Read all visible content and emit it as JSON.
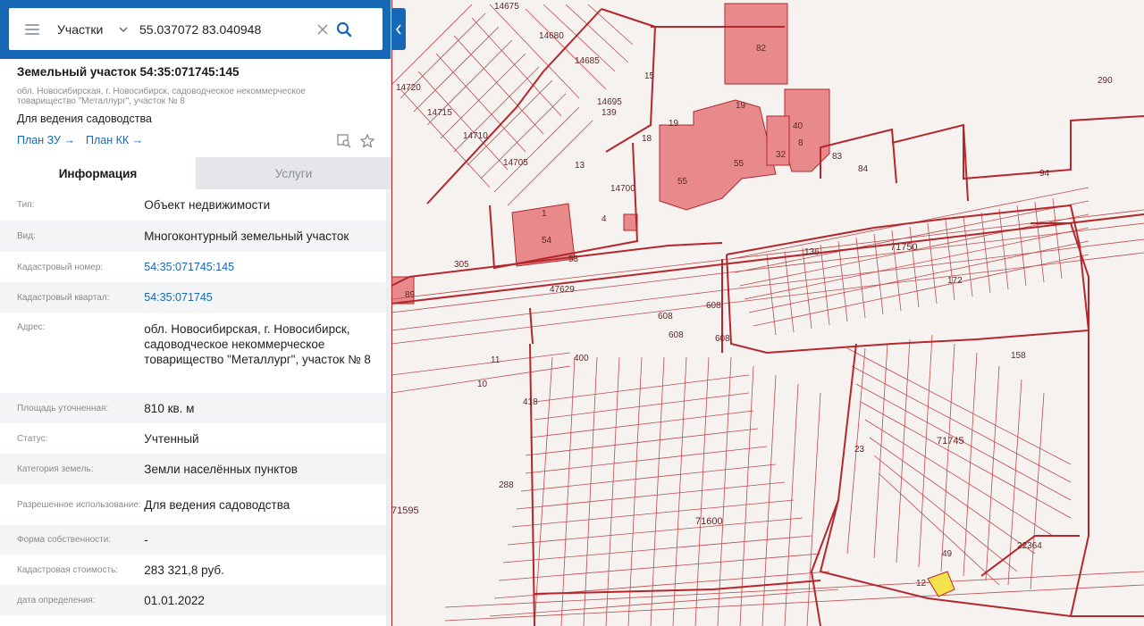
{
  "search": {
    "type_label": "Участки",
    "query": "55.037072 83.040948"
  },
  "parcel": {
    "title": "Земельный участок 54:35:071745:145",
    "address_short": "обл. Новосибирская, г. Новосибирск, садоводческое некоммерческое товарищество \"Металлург\", участок № 8",
    "purpose": "Для ведения садоводства",
    "plan_zu": "План ЗУ →",
    "plan_kk": "План КК →"
  },
  "tabs": [
    {
      "label": "Информация",
      "active": true
    },
    {
      "label": "Услуги",
      "active": false
    }
  ],
  "info_rows": [
    {
      "key": "Тип:",
      "value": "Объект недвижимости"
    },
    {
      "key": "Вид:",
      "value": "Многоконтурный земельный участок"
    },
    {
      "key": "Кадастровый номер:",
      "value": "54:35:071745:145",
      "link": true
    },
    {
      "key": "Кадастровый квартал:",
      "value": "54:35:071745",
      "link": true
    },
    {
      "key": "Адрес:",
      "value": "обл. Новосибирская, г. Новосибирск, садоводческое некоммерческое товарищество \"Металлург\", участок № 8"
    },
    {
      "key": "Площадь уточненная:",
      "value": "810 кв. м"
    },
    {
      "key": "Статус:",
      "value": "Учтенный"
    },
    {
      "key": "Категория земель:",
      "value": "Земли населённых пунктов"
    },
    {
      "key": "Разрешенное использование:",
      "value": "Для ведения садоводства"
    },
    {
      "key": "Форма собственности:",
      "value": "-"
    },
    {
      "key": "Кадастровая стоимость:",
      "value": "283 321,8 руб."
    },
    {
      "key": "дата определения:",
      "value": "01.01.2022"
    }
  ],
  "map": {
    "colors": {
      "boundary": "#b3272d",
      "building": "#e8898c",
      "selected": "#f3e24b",
      "background": "#f5f2ef"
    },
    "labels": {
      "q14675": "14675",
      "q14680": "14680",
      "q14685": "14685",
      "q14695": "14695",
      "n139": "139",
      "q14720": "14720",
      "q14715": "14715",
      "q14710": "14710",
      "q14705": "14705",
      "q14700": "14700",
      "n82": "82",
      "n19a": "19",
      "n19b": "19",
      "n55a": "55",
      "n55b": "55",
      "n40": "40",
      "n8": "8",
      "n32": "32",
      "n83": "83",
      "n84": "84",
      "n290": "290",
      "n15": "15",
      "n18": "18",
      "n13": "13",
      "n54": "54",
      "n4": "4",
      "n1": "1",
      "n53": "53",
      "n305": "305",
      "n89": "89",
      "q47629": "47629",
      "n136": "136",
      "q71750": "71750",
      "n172": "172",
      "n608a": "608",
      "n608b": "608",
      "n608c": "608",
      "n608d": "608",
      "n400": "400",
      "n11": "11",
      "n10": "10",
      "n418": "418",
      "n158": "158",
      "n94": "94",
      "q71745": "71745",
      "q71600": "71600",
      "q71595": "71595",
      "q22364": "22364",
      "n288": "288",
      "n23": "23",
      "n12": "12",
      "n49": "49"
    }
  }
}
